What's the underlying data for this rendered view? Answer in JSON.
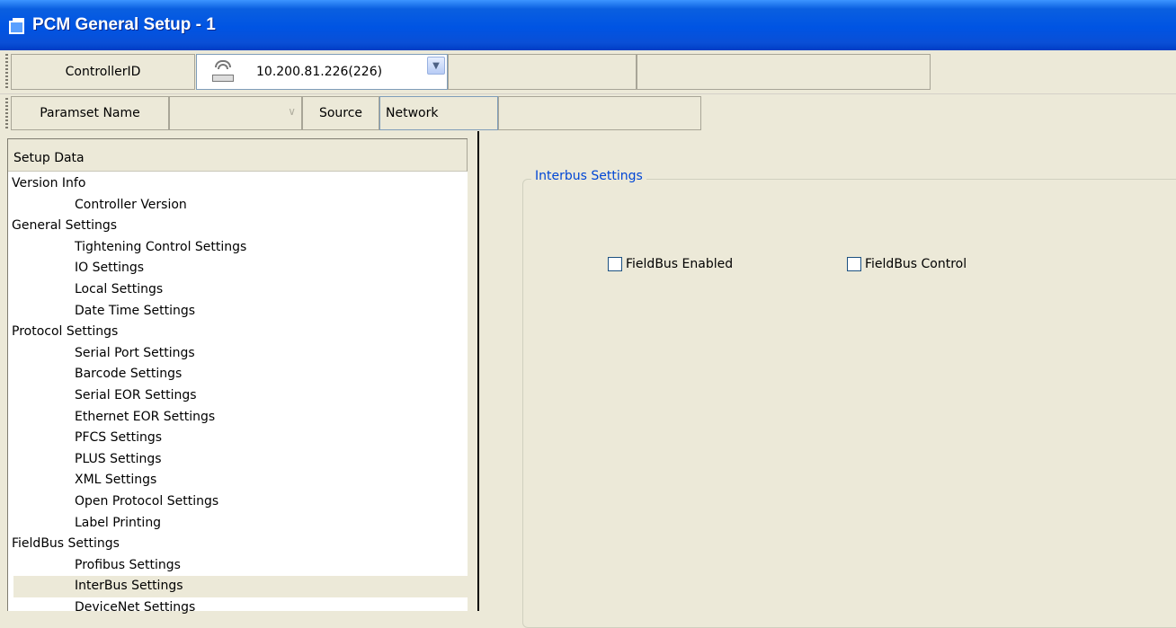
{
  "window": {
    "title": "PCM General Setup - 1"
  },
  "toolbar": {
    "controller_label": "ControllerID",
    "controller_value": "10.200.81.226(226)",
    "paramset_label": "Paramset Name",
    "paramset_value": "",
    "source_label": "Source",
    "source_value": "Network"
  },
  "tree": {
    "header": "Setup Data",
    "items": [
      {
        "label": "Version Info",
        "level": 0
      },
      {
        "label": "Controller Version",
        "level": 1
      },
      {
        "label": "General Settings",
        "level": 0
      },
      {
        "label": "Tightening Control Settings",
        "level": 1
      },
      {
        "label": "IO Settings",
        "level": 1
      },
      {
        "label": "Local Settings",
        "level": 1
      },
      {
        "label": "Date Time Settings",
        "level": 1
      },
      {
        "label": "Protocol Settings",
        "level": 0
      },
      {
        "label": "Serial Port Settings",
        "level": 1
      },
      {
        "label": "Barcode Settings",
        "level": 1
      },
      {
        "label": "Serial EOR Settings",
        "level": 1
      },
      {
        "label": "Ethernet EOR Settings",
        "level": 1
      },
      {
        "label": "PFCS Settings",
        "level": 1
      },
      {
        "label": "PLUS Settings",
        "level": 1
      },
      {
        "label": "XML Settings",
        "level": 1
      },
      {
        "label": "Open Protocol Settings",
        "level": 1
      },
      {
        "label": "Label Printing",
        "level": 1
      },
      {
        "label": "FieldBus Settings",
        "level": 0
      },
      {
        "label": "Profibus Settings",
        "level": 1
      },
      {
        "label": "InterBus Settings",
        "level": 1,
        "selected": true
      },
      {
        "label": "DeviceNet Settings",
        "level": 1
      }
    ]
  },
  "panel": {
    "group_title": "Interbus Settings",
    "fieldbus_enabled_label": "FieldBus Enabled",
    "fieldbus_enabled_checked": false,
    "fieldbus_control_label": "FieldBus Control",
    "fieldbus_control_checked": false
  }
}
